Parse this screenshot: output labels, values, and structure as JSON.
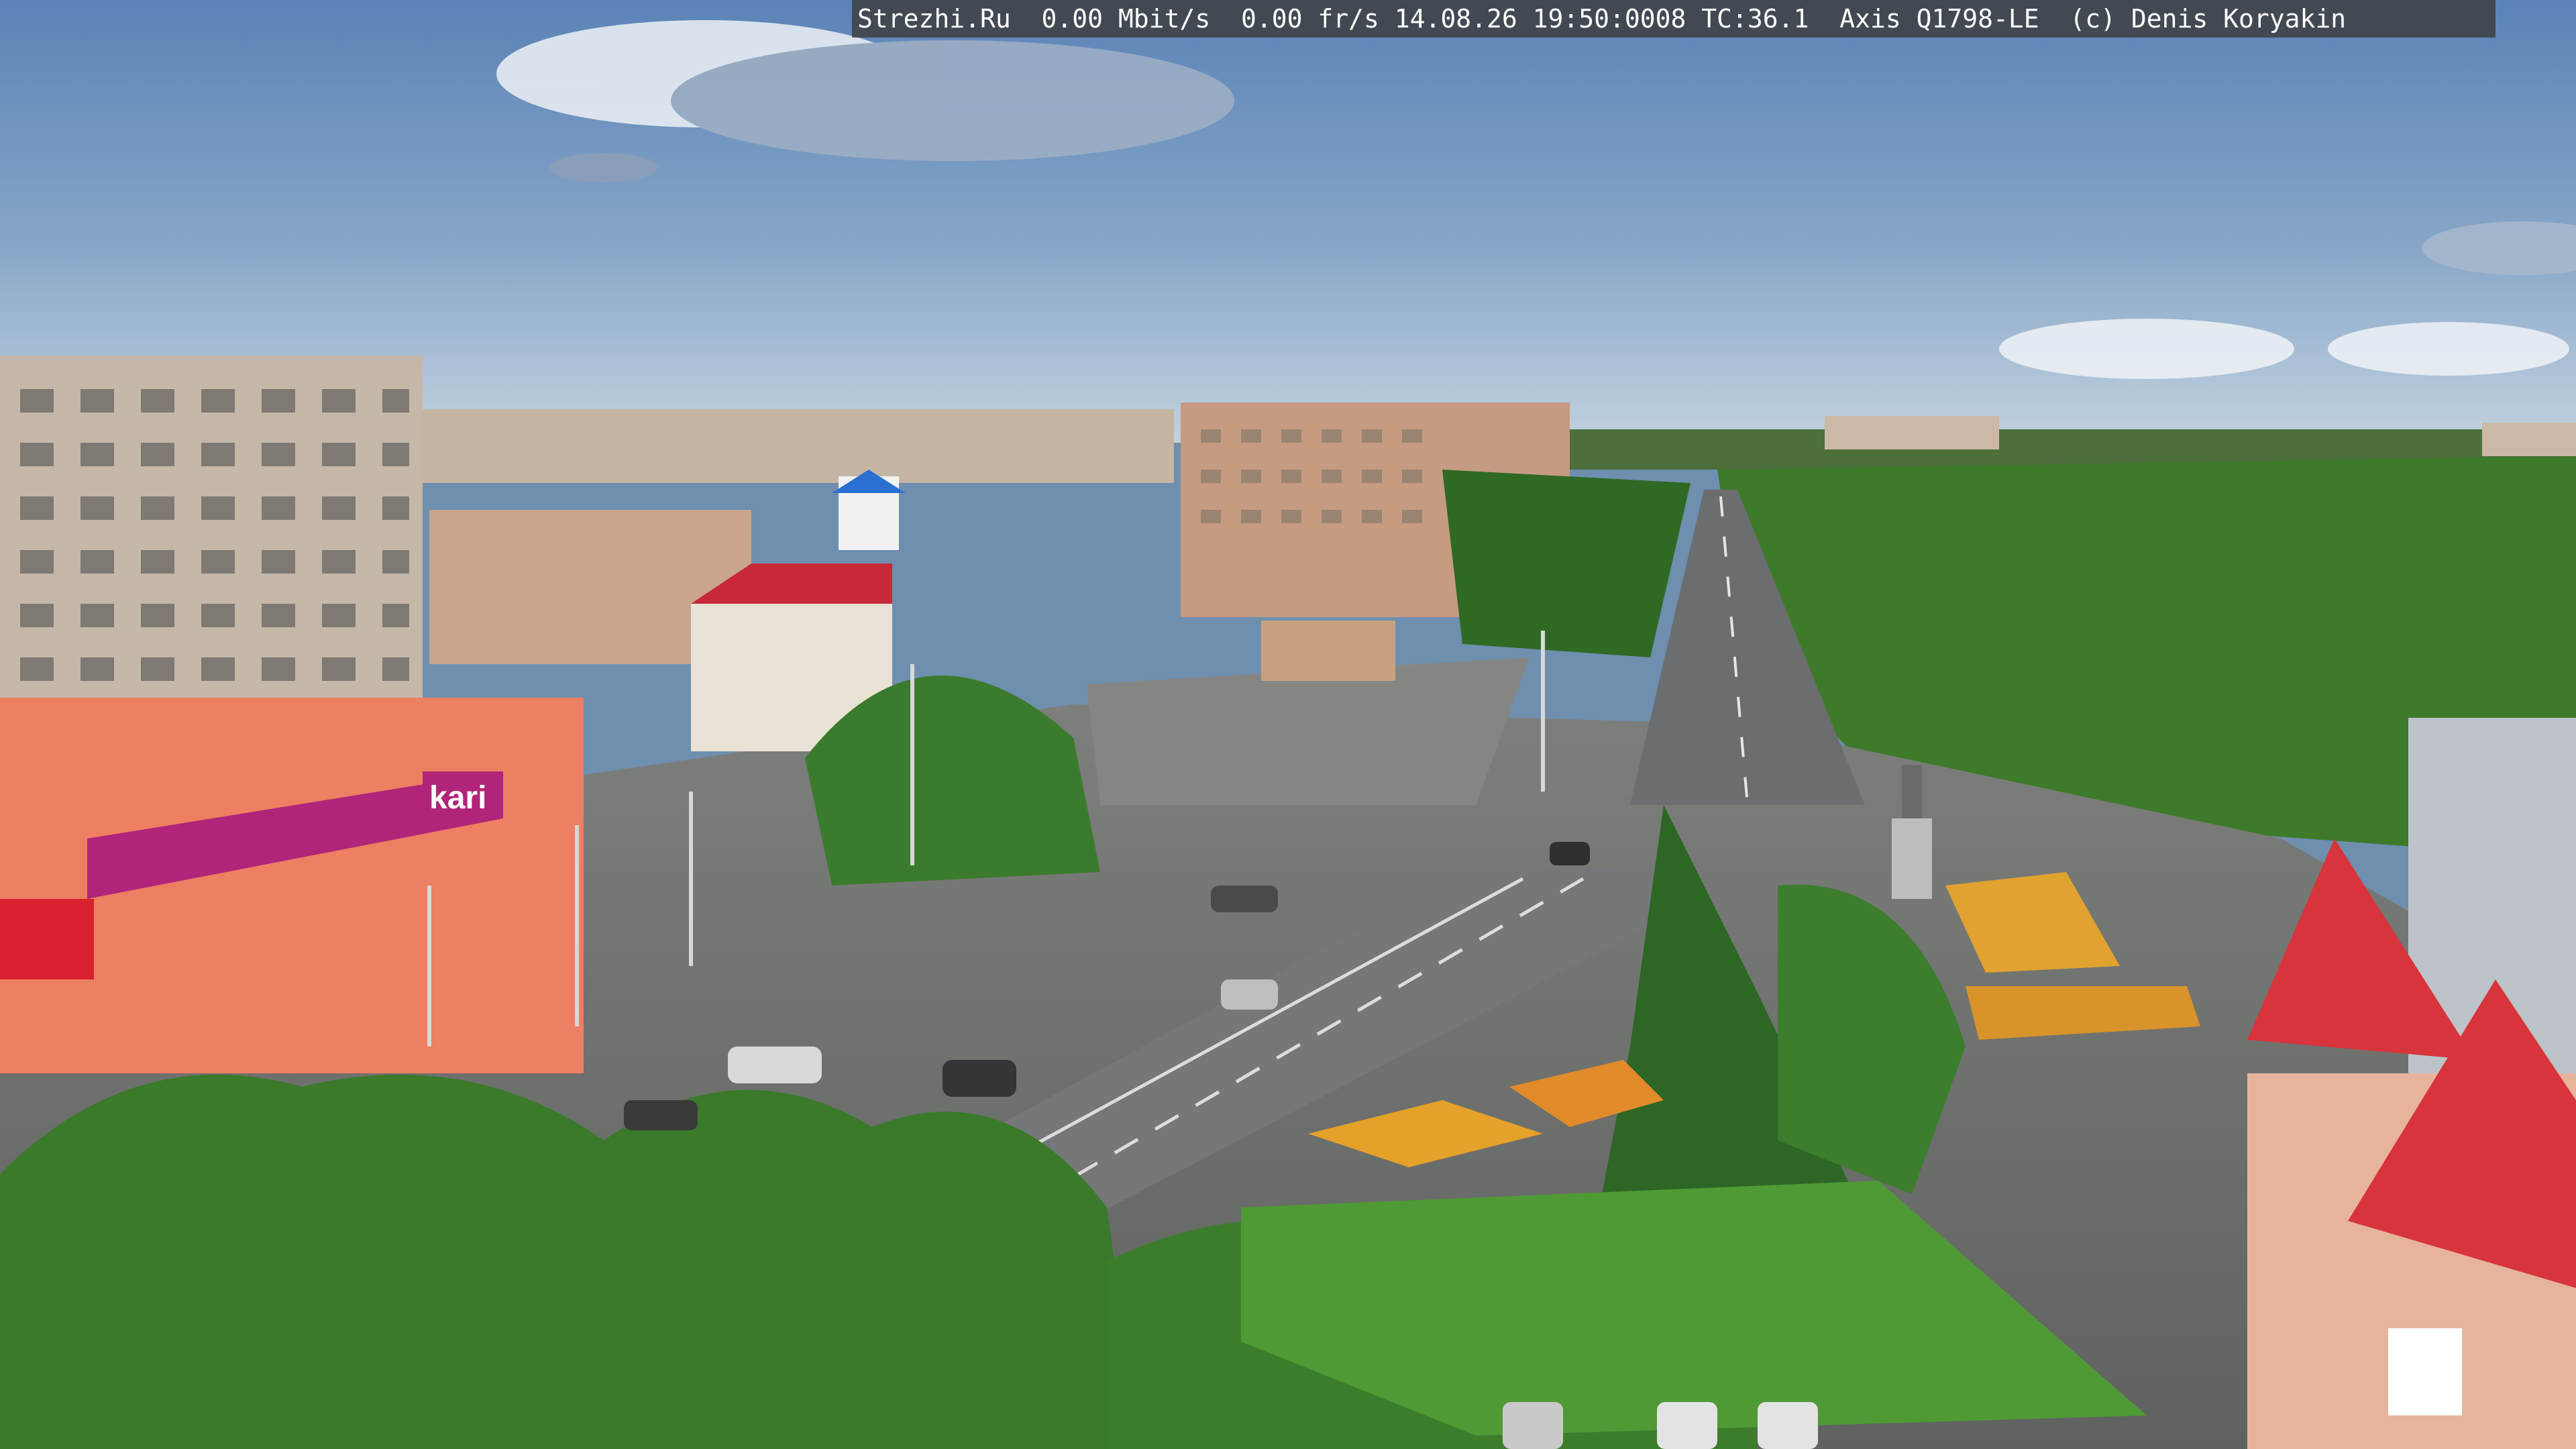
{
  "overlay": {
    "osd_text": "Strezhi.Ru  0.00 Mbit/s  0.00 fr/s 14.08.26 19:50:0008 TC:36.1  Axis Q1798-LE  (c) Denis Koryakin"
  },
  "signs": {
    "store_logo": "kari"
  },
  "colors": {
    "sky_top": "#5f86b8",
    "sky_horizon": "#b9cbdc",
    "foliage": "#3f7a2c",
    "asphalt": "#6f6f70",
    "roof_red": "#d8343c",
    "store_magenta": "#b0257a"
  }
}
